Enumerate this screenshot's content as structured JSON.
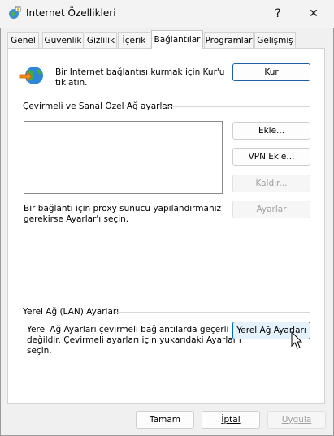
{
  "window": {
    "title": "Internet Özellikleri",
    "help_glyph": "?",
    "close_glyph": "✕"
  },
  "tabs": [
    {
      "label": "Genel"
    },
    {
      "label": "Güvenlik"
    },
    {
      "label": "Gizlilik"
    },
    {
      "label": "İçerik"
    },
    {
      "label": "Bağlantılar",
      "active": true
    },
    {
      "label": "Programlar"
    },
    {
      "label": "Gelişmiş"
    }
  ],
  "setup": {
    "text_line1": "Bir Internet bağlantısı kurmak için Kur'u",
    "text_line2": "tıklatın.",
    "button": "Kur",
    "icon": "network-globe-icon"
  },
  "dialup": {
    "section_label": "Çevirmeli ve Sanal Özel Ağ ayarları",
    "add_button": "Ekle...",
    "add_vpn_button": "VPN Ekle...",
    "remove_button": "Kaldır...",
    "settings_button": "Ayarlar",
    "proxy_text_line1": "Bir bağlantı için proxy sunucu yapılandırmanız",
    "proxy_text_line2": "gerekirse Ayarlar'ı seçin."
  },
  "lan": {
    "section_label": "Yerel Ağ (LAN) Ayarları",
    "text_line1": "Yerel Ağ Ayarları çevirmeli bağlantılarda geçerli",
    "text_line2": "değildir. Çevirmeli ayarları için yukarıdaki Ayarlar'ı",
    "text_line3": "seçin.",
    "button": "Yerel Ağ Ayarları"
  },
  "footer": {
    "ok_button": "Tamam",
    "cancel_button": "İptal",
    "apply_button": "Uygula"
  },
  "colors": {
    "accent": "#0067c0",
    "disabled_text": "#a0a0a0"
  }
}
